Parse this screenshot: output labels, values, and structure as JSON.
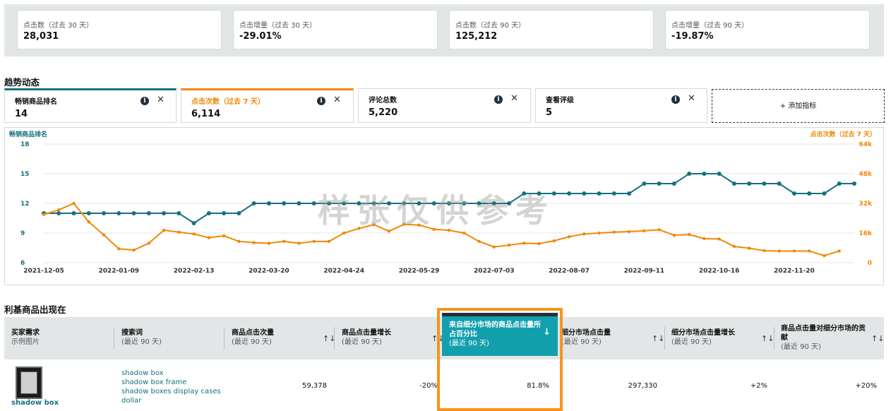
{
  "top_stats": [
    {
      "label": "点击数（过去 30 天）",
      "value": "28,031"
    },
    {
      "label": "点击增量（过去 30 天）",
      "value": "-29.01%"
    },
    {
      "label": "点击数（过去 90 天）",
      "value": "125,212"
    },
    {
      "label": "点击增量（过去 90 天）",
      "value": "-19.87%"
    }
  ],
  "trend": {
    "title": "趋势动态",
    "metrics": [
      {
        "label": "畅销商品排名",
        "value": "14"
      },
      {
        "label": "点击次数（过去 7 天）",
        "value": "6,114"
      },
      {
        "label": "评论总数",
        "value": "5,220"
      },
      {
        "label": "查看评级",
        "value": "5"
      }
    ],
    "add_metric": "+ 添加指标",
    "info_glyph": "i",
    "close_glyph": "✕"
  },
  "watermark": "样张仅供参考",
  "chart_data": {
    "type": "line",
    "left_axis_label": "畅销商品排名",
    "right_axis_label": "点击次数（过去 7 天）",
    "x_ticks": [
      "2021-12-05",
      "2022-01-09",
      "2022-02-13",
      "2022-03-20",
      "2022-04-24",
      "2022-05-29",
      "2022-07-03",
      "2022-08-07",
      "2022-09-11",
      "2022-10-16",
      "2022-11-20"
    ],
    "y_left_ticks": [
      "18",
      "15",
      "12",
      "9",
      "6"
    ],
    "y_left_range": [
      6,
      18
    ],
    "y_right_ticks": [
      "64k",
      "48k",
      "32k",
      "16k",
      "0"
    ],
    "y_right_range": [
      0,
      64000
    ],
    "colors": {
      "rank": "#15717f",
      "clicks": "#f08804"
    },
    "series": [
      {
        "name": "畅销商品排名",
        "axis": "left",
        "values": [
          11,
          11,
          11,
          11,
          11,
          11,
          11,
          11,
          11,
          11,
          10,
          11,
          11,
          11,
          12,
          12,
          12,
          12,
          12,
          12,
          12,
          12,
          12,
          12,
          12,
          12,
          12,
          12,
          12,
          12,
          12,
          12,
          13,
          13,
          13,
          13,
          13,
          13,
          13,
          13,
          14,
          14,
          14,
          15,
          15,
          15,
          14,
          14,
          14,
          14,
          13,
          13,
          13,
          14,
          14
        ]
      },
      {
        "name": "点击次数（过去 7 天）",
        "axis": "right",
        "values": [
          26000,
          28500,
          32000,
          22000,
          15000,
          7500,
          6800,
          10500,
          17500,
          16500,
          15500,
          13500,
          14500,
          11500,
          10800,
          10500,
          11500,
          10500,
          11500,
          11500,
          16000,
          18500,
          20500,
          17000,
          20700,
          20300,
          18000,
          17500,
          16000,
          11500,
          8500,
          9500,
          10500,
          10300,
          11800,
          14000,
          15500,
          16000,
          16500,
          16800,
          17200,
          17800,
          14800,
          15200,
          13000,
          12800,
          8800,
          7800,
          6500,
          6300,
          6300,
          6300,
          3800,
          6300
        ]
      }
    ]
  },
  "section2_title": "利基商品出现在",
  "table": {
    "headers": [
      {
        "label": "买家需求",
        "sub": "示例图片"
      },
      {
        "label": "搜索词",
        "sub": "(最近 90 天)"
      },
      {
        "label": "商品点击次量",
        "sub": "(最近 90 天)"
      },
      {
        "label": "商品点击量增长",
        "sub": "(最近 90 天)"
      },
      {
        "label": "来自细分市场的商品点击量所占百分比",
        "sub": "(最近 90 天)"
      },
      {
        "label": "细分市场点击量",
        "sub": "(最近 90 天)"
      },
      {
        "label": "细分市场点击量增长",
        "sub": "(最近 90 天)"
      },
      {
        "label": "商品点击量对细分市场的贡献",
        "sub": "(最近 90 天)"
      }
    ],
    "sort_glyph": "↑↓",
    "sort_active_glyph": "↓",
    "row": {
      "product_name": "shadow box",
      "keywords": [
        "shadow box",
        "shadow box frame",
        "shadow boxes display cases",
        "dollar"
      ],
      "product_clicks": "59,378",
      "click_growth": "-20%",
      "niche_share": "81.8%",
      "niche_clicks": "297,330",
      "niche_growth": "+2%",
      "contribution": "+20%"
    }
  }
}
